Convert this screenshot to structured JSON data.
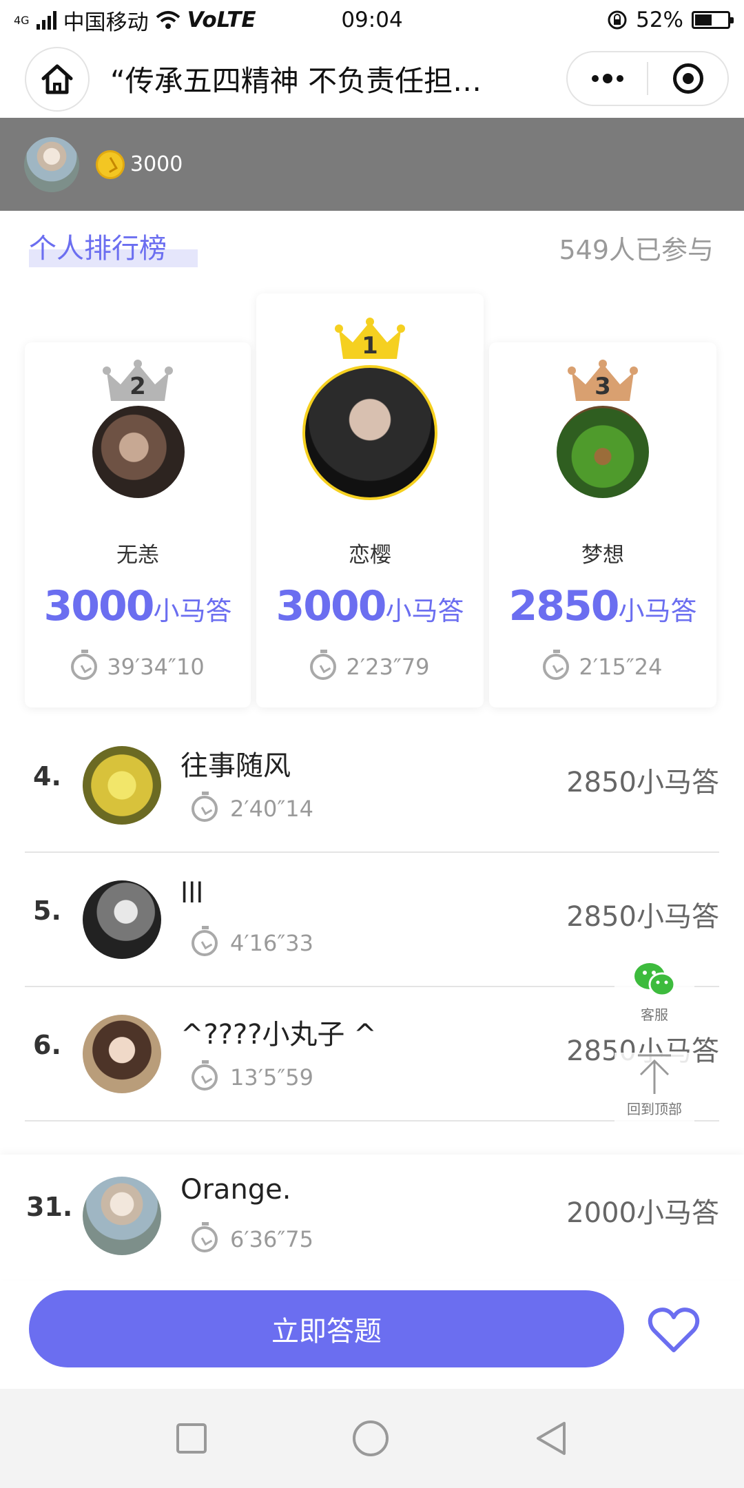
{
  "status_bar": {
    "network": "4G",
    "carrier": "中国移动",
    "volte": "VoLTE",
    "time": "09:04",
    "battery_percent": "52%",
    "battery_level": 0.52
  },
  "navbar": {
    "title": "“传承五四精神 不负责任担当”…"
  },
  "user": {
    "coins": "3000"
  },
  "ranking": {
    "tab_label": "个人排行榜",
    "participants": "549人已参与",
    "podium": [
      {
        "rank": "1",
        "name": "恋樱",
        "score": "3000",
        "unit": "小马答",
        "time": "2′23″79"
      },
      {
        "rank": "2",
        "name": "无恙",
        "score": "3000",
        "unit": "小马答",
        "time": "39′34″10"
      },
      {
        "rank": "3",
        "name": "梦想",
        "score": "2850",
        "unit": "小马答",
        "time": "2′15″24"
      }
    ],
    "list": [
      {
        "rank": "4.",
        "name": "往事随风",
        "time": "2′40″14",
        "score": "2850小马答"
      },
      {
        "rank": "5.",
        "name": "lll",
        "time": "4′16″33",
        "score": "2850小马答"
      },
      {
        "rank": "6.",
        "name": "^????小丸子 ^",
        "time": "13′5″59",
        "score": "2850小马答"
      }
    ],
    "me": {
      "rank": "31.",
      "name": "Orange.",
      "time": "6′36″75",
      "score": "2000小马答"
    }
  },
  "float": {
    "service_label": "客服",
    "top_label": "回到顶部"
  },
  "actions": {
    "answer_label": "立即答题"
  },
  "colors": {
    "accent": "#6b6ef0",
    "gold": "#f5d020",
    "silver": "#b5b5b5",
    "bronze": "#d9a070",
    "userbar": "#7b7b7b"
  }
}
